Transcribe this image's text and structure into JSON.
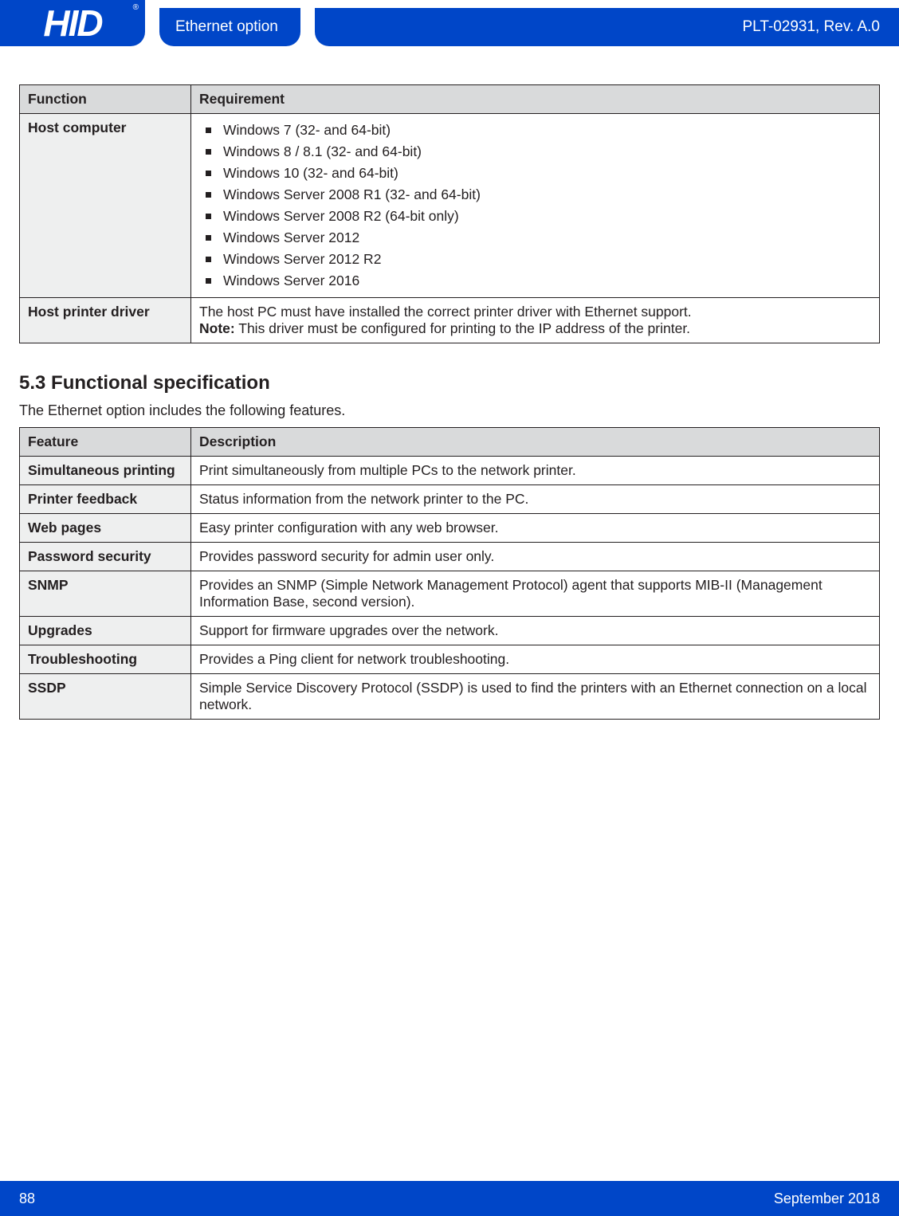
{
  "header": {
    "logo": "HID",
    "reg": "®",
    "title": "Ethernet option",
    "rev": "PLT-02931, Rev. A.0"
  },
  "table1": {
    "h1": "Function",
    "h2": "Requirement",
    "rows": [
      {
        "label": "Host computer",
        "list": [
          "Windows 7 (32- and 64-bit)",
          "Windows 8 / 8.1 (32- and 64-bit)",
          "Windows 10 (32- and 64-bit)",
          "Windows Server 2008 R1 (32- and 64-bit)",
          "Windows Server 2008 R2 (64-bit only)",
          "Windows Server 2012",
          "Windows Server 2012 R2",
          "Windows Server 2016"
        ]
      },
      {
        "label": "Host printer driver",
        "text": "The host PC must have installed the correct printer driver with Ethernet support.",
        "noteLabel": "Note:",
        "noteText": " This driver must be configured for printing to the IP address of the printer."
      }
    ]
  },
  "section": {
    "heading": "5.3 Functional specification",
    "intro": "The Ethernet option includes the following features."
  },
  "table2": {
    "h1": "Feature",
    "h2": "Description",
    "rows": [
      {
        "label": "Simultaneous printing",
        "text": "Print simultaneously from multiple PCs to the network printer."
      },
      {
        "label": "Printer feedback",
        "text": "Status information from the network printer to the PC."
      },
      {
        "label": "Web pages",
        "text": "Easy printer configuration with any web browser."
      },
      {
        "label": "Password security",
        "text": "Provides password security for admin user only."
      },
      {
        "label": "SNMP",
        "text": "Provides an SNMP (Simple Network Management Protocol) agent that supports MIB-II (Management Information Base, second version)."
      },
      {
        "label": "Upgrades",
        "text": "Support for firmware upgrades over the network."
      },
      {
        "label": "Troubleshooting",
        "text": "Provides a Ping client for network troubleshooting."
      },
      {
        "label": "SSDP",
        "text": "Simple Service Discovery Protocol (SSDP) is used to find the printers with an Ethernet connection on a local network."
      }
    ]
  },
  "footer": {
    "page": "88",
    "date": "September 2018"
  }
}
